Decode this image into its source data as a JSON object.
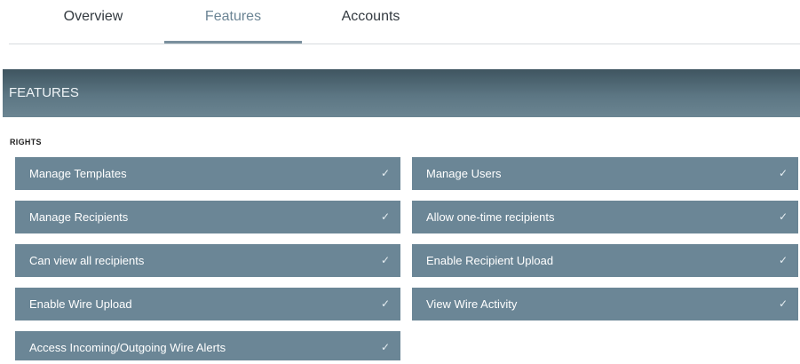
{
  "tabs": [
    {
      "label": "Overview"
    },
    {
      "label": "Features"
    },
    {
      "label": "Accounts"
    }
  ],
  "active_tab": "Features",
  "banner": {
    "title": "FEATURES"
  },
  "rights": {
    "label": "RIGHTS",
    "items": [
      {
        "label": "Manage Templates",
        "checked": true
      },
      {
        "label": "Manage Users",
        "checked": true
      },
      {
        "label": "Manage Recipients",
        "checked": true
      },
      {
        "label": "Allow one-time recipients",
        "checked": true
      },
      {
        "label": "Can view all recipients",
        "checked": true
      },
      {
        "label": "Enable Recipient Upload",
        "checked": true
      },
      {
        "label": "Enable Wire Upload",
        "checked": true
      },
      {
        "label": "View Wire Activity",
        "checked": true
      },
      {
        "label": "Access Incoming/Outgoing Wire Alerts",
        "checked": true
      }
    ],
    "check_glyph": "✓"
  },
  "colors": {
    "item_bg": "#6b8696",
    "banner_bg": "#4d6572",
    "active_tab": "#6c8595"
  }
}
